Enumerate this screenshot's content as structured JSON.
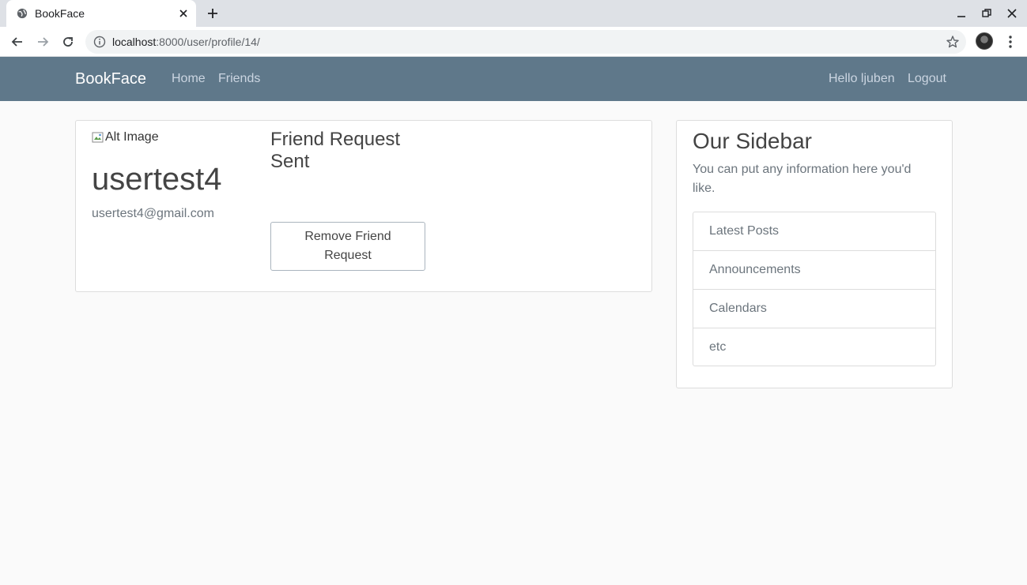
{
  "browser": {
    "tab_title": "BookFace",
    "url_host": "localhost",
    "url_rest": ":8000/user/profile/14/"
  },
  "nav": {
    "brand": "BookFace",
    "home": "Home",
    "friends": "Friends",
    "greeting": "Hello ljuben",
    "logout": "Logout"
  },
  "profile": {
    "image_alt": "Alt Image",
    "username": "usertest4",
    "email": "usertest4@gmail.com",
    "status_title": "Friend Request Sent",
    "remove_button": "Remove Friend Request"
  },
  "sidebar": {
    "title": "Our Sidebar",
    "text": "You can put any information here you'd like.",
    "items": [
      {
        "label": "Latest Posts"
      },
      {
        "label": "Announcements"
      },
      {
        "label": "Calendars"
      },
      {
        "label": "etc"
      }
    ]
  },
  "colors": {
    "navbar": "#5f788a",
    "page_bg": "#fafafa"
  }
}
